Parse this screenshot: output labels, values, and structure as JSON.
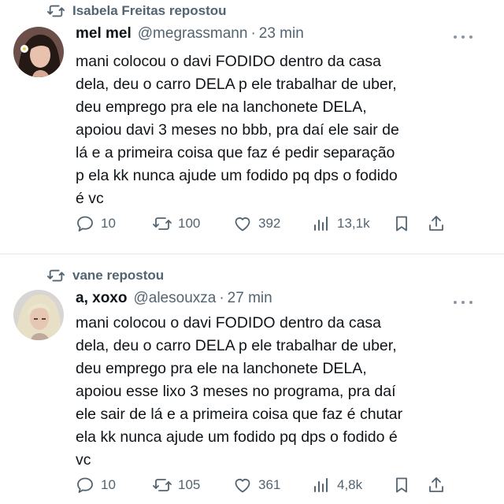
{
  "tweets": [
    {
      "reposted_by": "Isabela Freitas repostou",
      "display_name": "mel mel",
      "handle": "@megrassmann",
      "separator": "·",
      "time": "23 min",
      "lines": [
        "mani colocou o davi FODIDO dentro da casa",
        "dela, deu o carro DELA p ele trabalhar de uber,",
        "deu emprego pra ele na lanchonete DELA,",
        "apoiou davi 3 meses no bbb, pra daí ele sair de",
        "lá e a primeira coisa que faz é pedir separação",
        "p ela kk nunca ajude um fodido pq dps o fodido",
        "é vc"
      ],
      "replies": "10",
      "reposts": "100",
      "likes": "392",
      "views": "13,1k"
    },
    {
      "reposted_by": "vane repostou",
      "display_name": "a, xoxo",
      "handle": "@alesouxza",
      "separator": "·",
      "time": "27 min",
      "lines": [
        "mani colocou o davi FODIDO dentro da casa",
        "dela, deu o carro DELA p ele trabalhar de uber,",
        "deu emprego pra ele na lanchonete DELA,",
        "apoiou esse lixo 3 meses no programa, pra daí",
        "ele sair de lá e a primeira coisa que faz é chutar",
        "ela kk nunca ajude um fodido pq dps o fodido é",
        "vc"
      ],
      "replies": "10",
      "reposts": "105",
      "likes": "361",
      "views": "4,8k"
    }
  ],
  "icons": {
    "repost": "repost-icon",
    "reply": "reply-icon",
    "like": "heart-icon",
    "views": "views-icon",
    "bookmark": "bookmark-icon",
    "share": "share-icon",
    "more": "more-icon"
  },
  "colors": {
    "text": "#0f1419",
    "secondary": "#536471",
    "divider": "#e6e9ec"
  }
}
